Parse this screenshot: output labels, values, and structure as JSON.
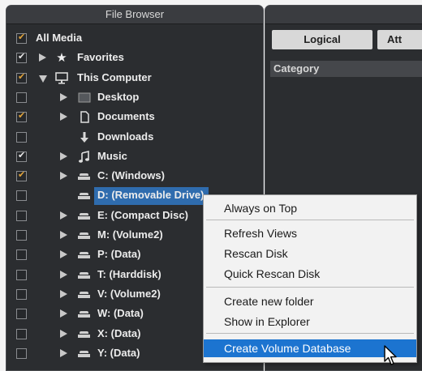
{
  "file_browser": {
    "title": "File Browser",
    "items": [
      {
        "label": "All Media",
        "check": "partial",
        "expander": "none",
        "icon": "none",
        "level": 0
      },
      {
        "label": "Favorites",
        "check": "checked",
        "expander": "right",
        "icon": "star-icon",
        "level": 1
      },
      {
        "label": "This Computer",
        "check": "partial",
        "expander": "down",
        "icon": "monitor-icon",
        "level": 1
      },
      {
        "label": "Desktop",
        "check": "none",
        "expander": "right",
        "icon": "desktop-icon",
        "level": 2
      },
      {
        "label": "Documents",
        "check": "partial",
        "expander": "right",
        "icon": "document-icon",
        "level": 2
      },
      {
        "label": "Downloads",
        "check": "none",
        "expander": "none",
        "icon": "download-arrow-icon",
        "level": 2
      },
      {
        "label": "Music",
        "check": "checked",
        "expander": "right",
        "icon": "music-note-icon",
        "level": 2
      },
      {
        "label": "C: (Windows)",
        "check": "partial",
        "expander": "right",
        "icon": "drive-icon",
        "level": 2
      },
      {
        "label": "D: (Removable Drive)",
        "check": "none",
        "expander": "none",
        "icon": "drive-icon",
        "level": 2,
        "selected": true
      },
      {
        "label": "E: (Compact Disc)",
        "check": "none",
        "expander": "right",
        "icon": "drive-icon",
        "level": 2
      },
      {
        "label": "M: (Volume2)",
        "check": "none",
        "expander": "right",
        "icon": "drive-icon",
        "level": 2
      },
      {
        "label": "P: (Data)",
        "check": "none",
        "expander": "right",
        "icon": "drive-icon",
        "level": 2
      },
      {
        "label": "T: (Harddisk)",
        "check": "none",
        "expander": "right",
        "icon": "drive-icon",
        "level": 2
      },
      {
        "label": "V: (Volume2)",
        "check": "none",
        "expander": "right",
        "icon": "drive-icon",
        "level": 2
      },
      {
        "label": "W: (Data)",
        "check": "none",
        "expander": "right",
        "icon": "drive-icon",
        "level": 2
      },
      {
        "label": "X: (Data)",
        "check": "none",
        "expander": "right",
        "icon": "drive-icon",
        "level": 2
      },
      {
        "label": "Y: (Data)",
        "check": "none",
        "expander": "right",
        "icon": "drive-icon",
        "level": 2
      }
    ]
  },
  "right_panel": {
    "tab_logical": "Logical",
    "tab_attributes_partial": "Att",
    "category_header": "Category"
  },
  "context_menu": {
    "items": [
      "Always on Top",
      "Refresh Views",
      "Rescan Disk",
      "Quick Rescan Disk",
      "Create new folder",
      "Show in Explorer",
      "Create Volume Database"
    ],
    "highlighted": "Create Volume Database"
  },
  "colors": {
    "selection_blue": "#2f6cae",
    "menu_highlight": "#1c74d0",
    "partial_check": "#e0a33a"
  }
}
